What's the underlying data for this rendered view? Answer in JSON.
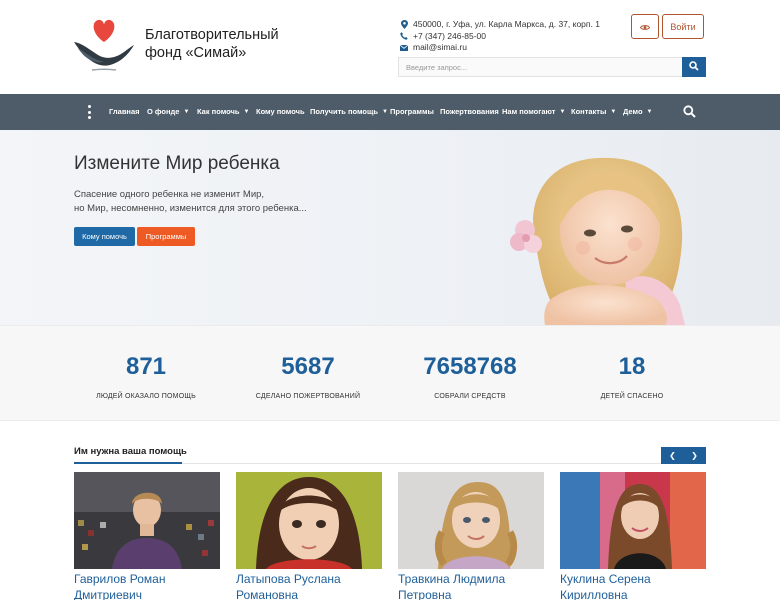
{
  "header": {
    "brand_line1": "Благотворительный",
    "brand_line2": "фонд «Симай»",
    "address": "450000, г. Уфа, ул. Карла Маркса, д. 37, корп. 1",
    "phone": "+7 (347) 246-85-00",
    "email": "mail@simai.ru",
    "login_label": "Войти",
    "search_placeholder": "Введите запрос..."
  },
  "nav": {
    "items": [
      {
        "label": "Главная"
      },
      {
        "label": "О фонде"
      },
      {
        "label": "Как помочь"
      },
      {
        "label": "Кому помочь"
      },
      {
        "label": "Получить помощь"
      },
      {
        "label": "Программы"
      },
      {
        "label": "Пожертвования"
      },
      {
        "label": "Нам помогают"
      },
      {
        "label": "Контакты"
      },
      {
        "label": "Демо"
      }
    ]
  },
  "hero": {
    "title": "Измените Мир ребенка",
    "text_line1": "Спасение одного ребенка не изменит Мир,",
    "text_line2": "но Мир, несомненно, изменится для этого ребенка...",
    "btn_help": "Кому помочь",
    "btn_programs": "Программы"
  },
  "stats": [
    {
      "value": "871",
      "label": "ЛЮДЕЙ ОКАЗАЛО ПОМОЩЬ"
    },
    {
      "value": "5687",
      "label": "СДЕЛАНО ПОЖЕРТВОВАНИЙ"
    },
    {
      "value": "7658768",
      "label": "СОБРАЛИ СРЕДСТВ"
    },
    {
      "value": "18",
      "label": "ДЕТЕЙ СПАСЕНО"
    }
  ],
  "need_help": {
    "title": "Им нужна ваша помощь",
    "cards": [
      {
        "name_line1": "Гаврилов Роман",
        "name_line2": "Дмитриевич"
      },
      {
        "name_line1": "Латыпова Руслана",
        "name_line2": "Романовна"
      },
      {
        "name_line1": "Травкина Людмила",
        "name_line2": "Петровна"
      },
      {
        "name_line1": "Куклина Серена",
        "name_line2": "Кирилловна"
      }
    ]
  },
  "colors": {
    "brand_blue": "#1f5f99",
    "accent_orange": "#ee5a23",
    "nav_bg": "#4d5c68",
    "heart_red": "#e8473e",
    "outline_brown": "#b0542e"
  },
  "icons": [
    "heart-hand-logo",
    "location-pin-icon",
    "phone-icon",
    "mail-icon",
    "eye-icon",
    "search-icon",
    "menu-dots-icon",
    "chevron-down-icon",
    "chevron-left-icon",
    "chevron-right-icon"
  ]
}
